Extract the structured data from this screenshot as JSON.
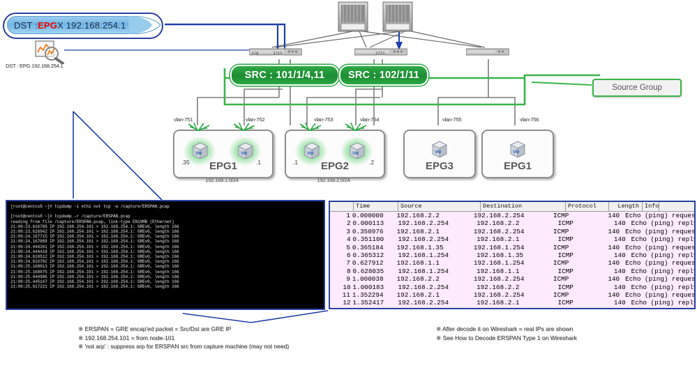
{
  "callout": {
    "dst_prefix": "DST : ",
    "dst_epg": "EPG",
    "dst_suffix": " X 192.168.254.1",
    "capture_label": "DST : EPG 192.168.254.1",
    "capture_icon": "magnifier-chart-icon"
  },
  "fabric": {
    "spines": [
      "spine-1",
      "spine-2"
    ],
    "leafs": [
      {
        "name": "leaf-101",
        "ports": [
          "1/4",
          "1/11"
        ]
      },
      {
        "name": "leaf-102",
        "ports": [
          "1/11"
        ]
      },
      {
        "name": "leaf-103",
        "ports": []
      }
    ],
    "src_groups": [
      {
        "label": "SRC : 101/1/4,11"
      },
      {
        "label": "SRC : 102/1/11"
      }
    ],
    "source_group_label": "Source Group",
    "accent_green": "#2aa843",
    "accent_blue": "#2a3fa0"
  },
  "epgs": [
    {
      "name": "EPG1",
      "subnet": "192.168.1.0/24",
      "hosts": [
        {
          "vlan": "vlan-751",
          "ip_suffix": ".35",
          "glow": true
        },
        {
          "vlan": "vlan-752",
          "ip_suffix": ".1",
          "glow": true
        }
      ]
    },
    {
      "name": "EPG2",
      "subnet": "192.168.2.0/24",
      "hosts": [
        {
          "vlan": "vlan-753",
          "ip_suffix": ".1",
          "glow": true
        },
        {
          "vlan": "vlan-754",
          "ip_suffix": ".2",
          "glow": true
        }
      ]
    },
    {
      "name": "EPG3",
      "subnet": "",
      "hosts": [
        {
          "vlan": "vlan-755",
          "ip_suffix": "",
          "glow": false
        }
      ]
    },
    {
      "name": "EPG1",
      "subnet": "",
      "hosts": [
        {
          "vlan": "vlan-756",
          "ip_suffix": "",
          "glow": false
        }
      ]
    }
  ],
  "terminal": {
    "text": "[root@centos8 ~]# tcpdump -i eth1 not tcp -w /capture/ERSPAN.pcap\n\n[root@centos8 ~]# tcpdump -r /capture/ERSPAN.pcap\nreading from file /capture/ERSPAN.pcap, link-type EN10MB (Ethernet)\n21:09:23.616789 IP 192.168.254.101 > 192.168.254.1: GREv0, length 166\n21:09:23.616942 IP 192.168.254.101 > 192.168.254.1: GREv0, length 166\n21:09:24.167715 IP 192.168.254.101 > 192.168.254.1: GREv0, length 166\n21:09:24.167889 IP 192.168.254.101 > 192.168.254.1: GREv0, length 166\n21:09:24.444261 IP 192.168.254.101 > 192.168.254.1: GREv0, length 166\n21:09:24.444418 IP 192.168.254.101 > 192.168.254.1: GREv0, length 166\n21:09:24.616512 IP 192.168.254.101 > 192.168.254.1: GREv0, length 166\n21:09:24.616702 IP 192.168.254.101 > 192.168.254.1: GREv0, length 166\n21:09:25.168813 IP 192.168.254.101 > 192.168.254.1: GREv0, length 166\n21:09:25.168975 IP 192.168.254.101 > 192.168.254.1: GREv0, length 166\n21:09:25.444986 IP 192.168.254.101 > 192.168.254.1: GREv0, length 166\n21:09:25.445147 IP 192.168.254.101 > 192.168.254.1: GREv0, length 166\n21:09:25.617221 IP 192.168.254.101 > 192.168.254.1: GREv0, length 166"
  },
  "wireshark": {
    "columns": [
      "",
      "Time",
      "Source",
      "Destination",
      "Protocol",
      "Length",
      "Info"
    ],
    "rows": [
      [
        "1",
        "0.000000",
        "192.168.2.2",
        "192.168.2.254",
        "ICMP",
        "140",
        "Echo (ping) request"
      ],
      [
        "2",
        "0.000113",
        "192.168.2.254",
        "192.168.2.2",
        "ICMP",
        "140",
        "Echo (ping) reply"
      ],
      [
        "3",
        "0.350976",
        "192.168.2.1",
        "192.168.2.254",
        "ICMP",
        "140",
        "Echo (ping) request"
      ],
      [
        "4",
        "0.351100",
        "192.168.2.254",
        "192.168.2.1",
        "ICMP",
        "140",
        "Echo (ping) reply"
      ],
      [
        "5",
        "0.365184",
        "192.168.1.35",
        "192.168.1.254",
        "ICMP",
        "140",
        "Echo (ping) request"
      ],
      [
        "6",
        "0.365312",
        "192.168.1.254",
        "192.168.1.35",
        "ICMP",
        "140",
        "Echo (ping) reply"
      ],
      [
        "7",
        "0.627912",
        "192.168.1.1",
        "192.168.1.254",
        "ICMP",
        "140",
        "Echo (ping) request"
      ],
      [
        "8",
        "0.628035",
        "192.168.1.254",
        "192.168.1.1",
        "ICMP",
        "140",
        "Echo (ping) reply"
      ],
      [
        "9",
        "1.000038",
        "192.168.2.2",
        "192.168.2.254",
        "ICMP",
        "140",
        "Echo (ping) request"
      ],
      [
        "10",
        "1.000183",
        "192.168.2.254",
        "192.168.2.2",
        "ICMP",
        "140",
        "Echo (ping) reply"
      ],
      [
        "11",
        "1.352294",
        "192.168.2.1",
        "192.168.2.254",
        "ICMP",
        "140",
        "Echo (ping) request"
      ],
      [
        "12",
        "1.352417",
        "192.168.2.254",
        "192.168.2.1",
        "ICMP",
        "140",
        "Echo (ping) reply"
      ]
    ]
  },
  "notes": {
    "left": "※ ERSPAN = GRE encap'ed packet = Src/Dst are GRE IP\n※ 192.168.254.101 = from node-101\n※ 'not arp' : suppress arp for ERSPAN src from capture machine (may not need)",
    "right": "※ After decode it on Wireshark = real IPs are shown\n※ See How to Decode ERSPAN Type 1 on Wireshark"
  }
}
